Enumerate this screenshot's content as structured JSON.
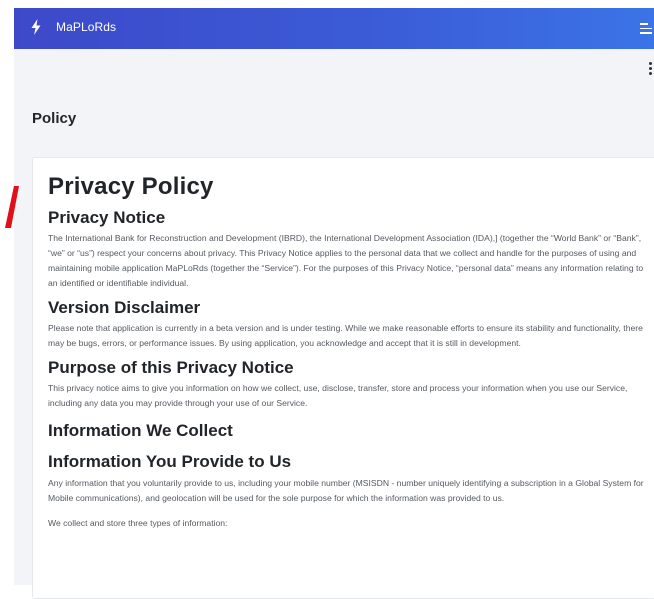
{
  "app": {
    "title": "MaPLoRds",
    "logo_icon": "lightning-bolt-icon",
    "menu_icon": "hamburger-menu-icon",
    "options_icon": "vertical-dots-icon"
  },
  "page": {
    "title": "Policy"
  },
  "policy": {
    "heading": "Privacy Policy",
    "sections": [
      {
        "heading": "Privacy Notice",
        "paragraphs": [
          "The International Bank for Reconstruction and Development (IBRD), the International Development Association (IDA),] (together the “World Bank” or “Bank”, “we” or “us”) respect your concerns about privacy. This Privacy Notice applies to the personal data that we collect and handle for the purposes of using and maintaining mobile application MaPLoRds (together the “Service”). For the purposes of this Privacy Notice, “personal data” means any information relating to an identified or identifiable individual."
        ]
      },
      {
        "heading": "Version Disclaimer",
        "paragraphs": [
          "Please note that application is currently in a beta version and is under testing. While we make reasonable efforts to ensure its stability and functionality, there may be bugs, errors, or performance issues. By using application, you acknowledge and accept that it is still in development."
        ]
      },
      {
        "heading": "Purpose of this Privacy Notice",
        "paragraphs": [
          "This privacy notice aims to give you information on how we collect, use, disclose, transfer, store and process your information when you use our Service, including any data you may provide through your use of our Service."
        ]
      },
      {
        "heading": "Information We Collect",
        "paragraphs": []
      },
      {
        "heading": "Information You Provide to Us",
        "paragraphs": [
          "Any information that you voluntarily provide to us, including your mobile number (MSISDN - number uniquely identifying a subscription in a Global System for Mobile communications), and geolocation will be used for the sole purpose for which the information was provided to us.",
          "We collect and store three types of information:"
        ]
      }
    ]
  },
  "colors": {
    "header_start": "#3d49c9",
    "header_end": "#3b74e6",
    "background": "#f3f4f8",
    "accent_mark": "#e0101a"
  }
}
